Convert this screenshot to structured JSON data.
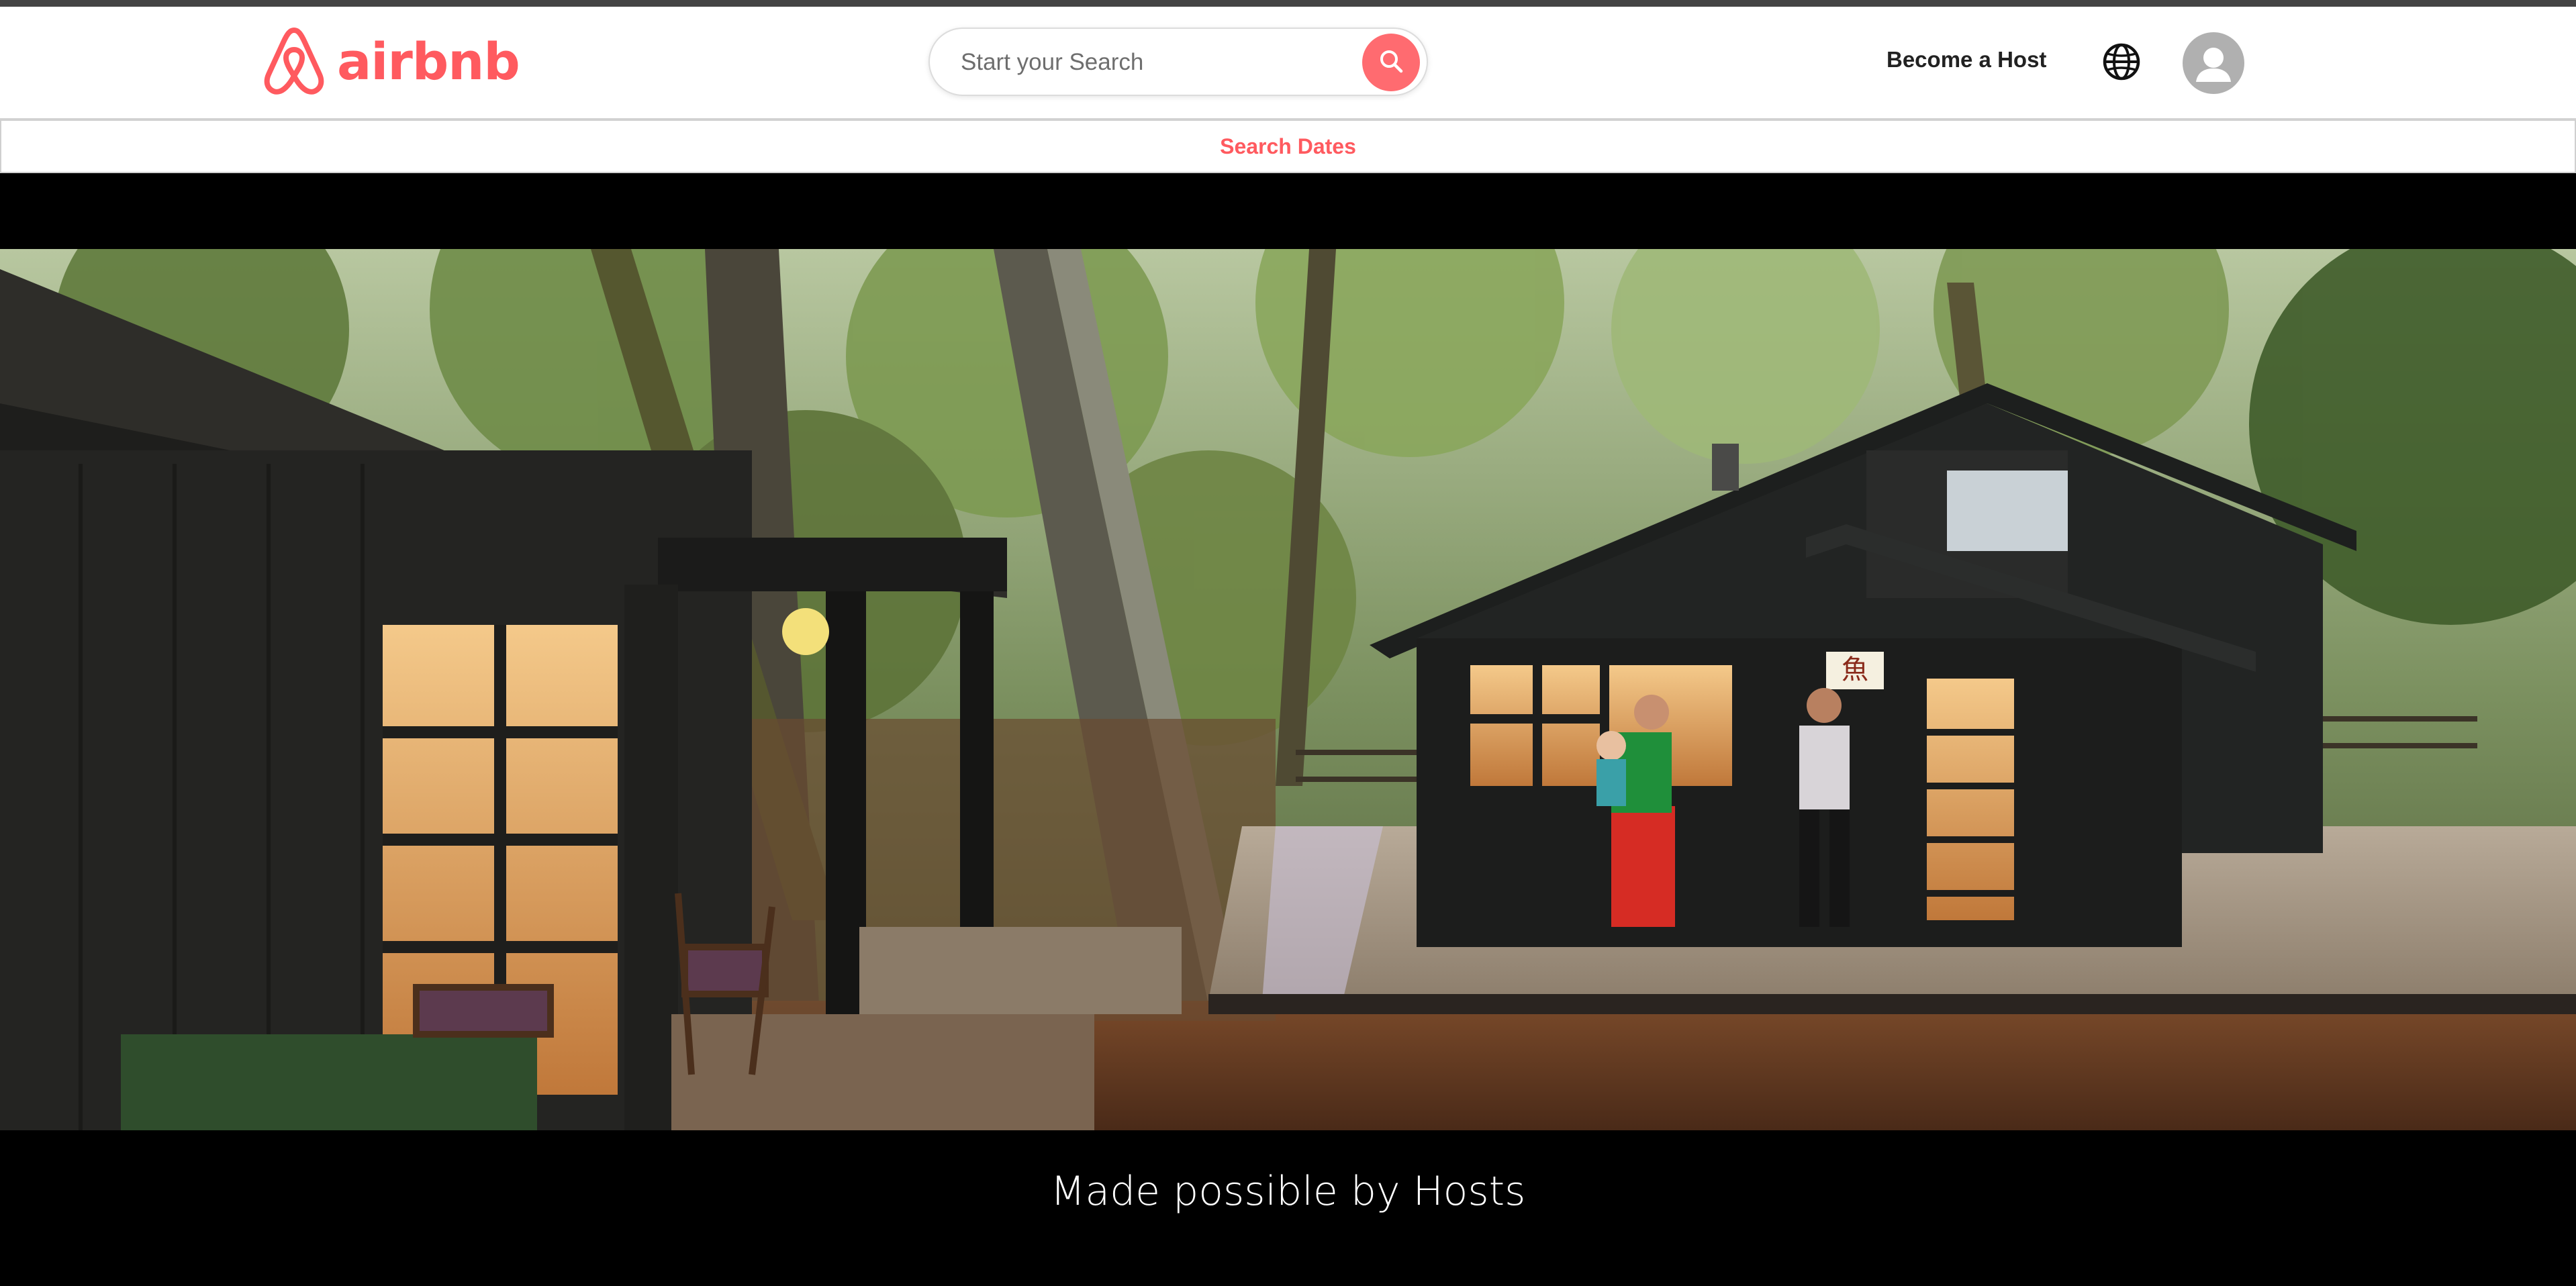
{
  "header": {
    "brand": "airbnb",
    "logo_icon": "airbnb-belo-icon",
    "search": {
      "placeholder": "Start your Search",
      "button_icon": "search-icon"
    },
    "become_host_label": "Become a Host",
    "globe_icon": "globe-icon",
    "avatar_icon": "user-avatar-icon"
  },
  "dates_bar": {
    "label": "Search Dates"
  },
  "hero": {
    "caption": "Made possible by Hosts"
  },
  "colors": {
    "brand": "#ff5a5f",
    "search_button": "#ff6b70",
    "page_background": "#000000",
    "header_background": "#ffffff"
  }
}
